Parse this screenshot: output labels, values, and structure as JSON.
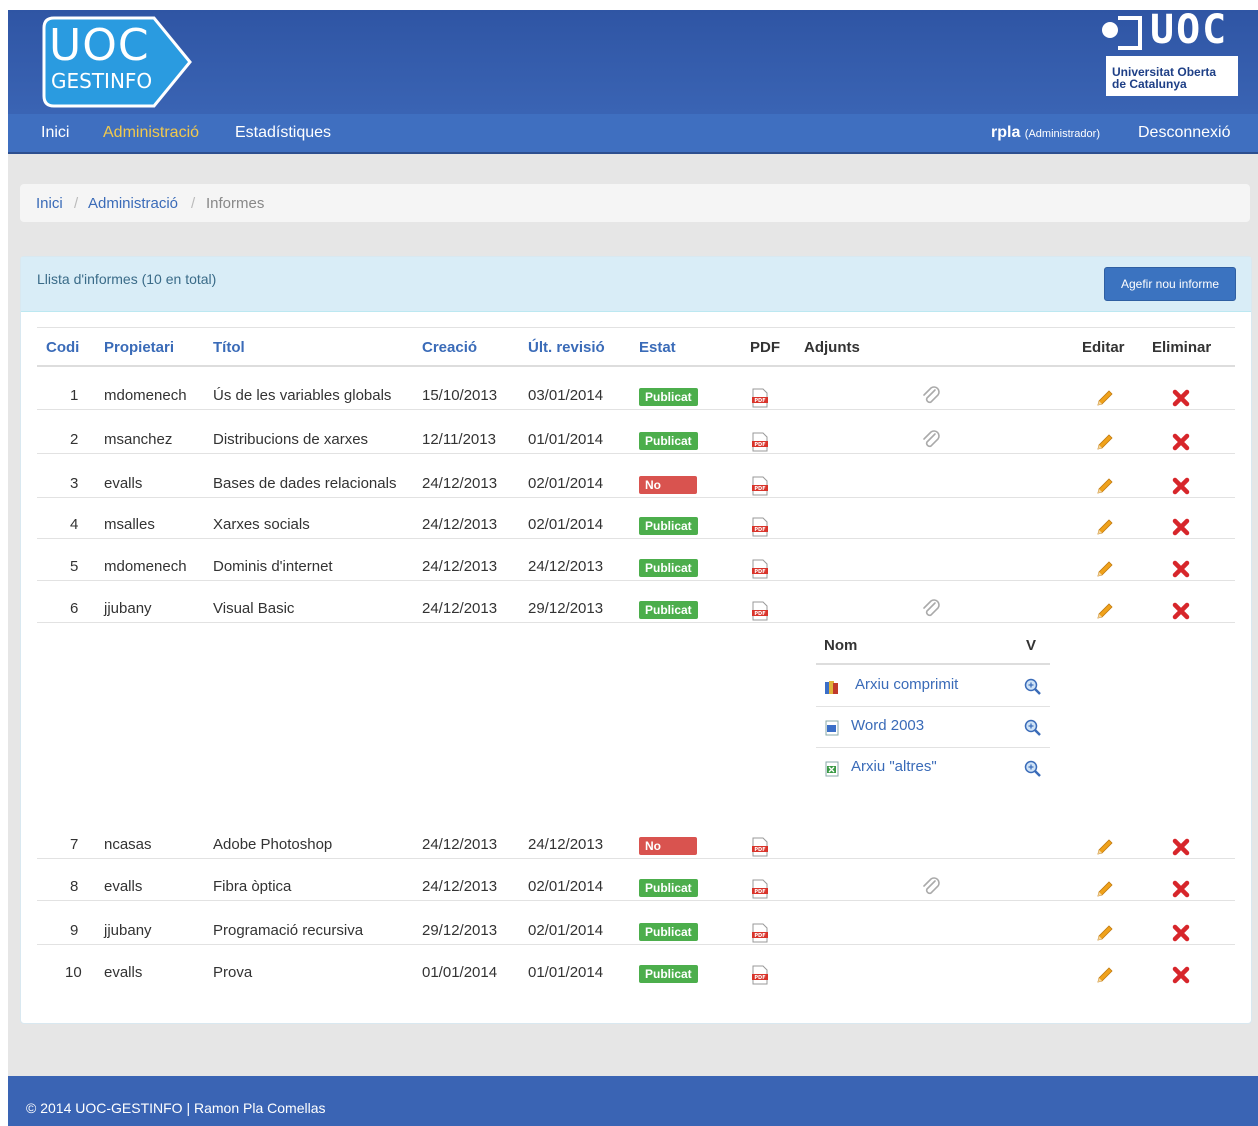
{
  "brand": {
    "logo_line1": "UOC",
    "logo_line2": "GESTINFO",
    "uni_word": "UOC",
    "uni_line1": "Universitat Oberta",
    "uni_line2": "de Catalunya"
  },
  "nav": {
    "items": [
      "Inici",
      "Administració",
      "Estadístiques"
    ],
    "active": "Administració",
    "user": "rpla",
    "role": "(Administrador)",
    "logout": "Desconnexió"
  },
  "breadcrumb": {
    "items": [
      "Inici",
      "Administració",
      "Informes"
    ],
    "separator": "/"
  },
  "panel": {
    "title": "Llista d'informes (10 en total)",
    "add_button": "Agefir nou informe"
  },
  "table": {
    "headers": [
      "Codi",
      "Propietari",
      "Títol",
      "Creació",
      "Últ. revisió",
      "Estat",
      "PDF",
      "Adjunts",
      "Editar",
      "Eliminar"
    ],
    "rows": [
      {
        "code": "1",
        "owner": "mdomenech",
        "title": "Ús de les variables globals",
        "created": "15/10/2013",
        "revised": "03/01/2014",
        "status": "Publicat",
        "published": true,
        "attachment": true
      },
      {
        "code": "2",
        "owner": "msanchez",
        "title": "Distribucions de xarxes",
        "created": "12/11/2013",
        "revised": "01/01/2014",
        "status": "Publicat",
        "published": true,
        "attachment": true
      },
      {
        "code": "3",
        "owner": "evalls",
        "title": "Bases de dades relacionals",
        "created": "24/12/2013",
        "revised": "02/01/2014",
        "status": "No publicat",
        "published": false,
        "attachment": false
      },
      {
        "code": "4",
        "owner": "msalles",
        "title": "Xarxes socials",
        "created": "24/12/2013",
        "revised": "02/01/2014",
        "status": "Publicat",
        "published": true,
        "attachment": false
      },
      {
        "code": "5",
        "owner": "mdomenech",
        "title": "Dominis d'internet",
        "created": "24/12/2013",
        "revised": "24/12/2013",
        "status": "Publicat",
        "published": true,
        "attachment": false
      },
      {
        "code": "6",
        "owner": "jjubany",
        "title": "Visual Basic",
        "created": "24/12/2013",
        "revised": "29/12/2013",
        "status": "Publicat",
        "published": true,
        "attachment": true
      },
      {
        "code": "7",
        "owner": "ncasas",
        "title": "Adobe Photoshop",
        "created": "24/12/2013",
        "revised": "24/12/2013",
        "status": "No publicat",
        "published": false,
        "attachment": false
      },
      {
        "code": "8",
        "owner": "evalls",
        "title": "Fibra òptica",
        "created": "24/12/2013",
        "revised": "02/01/2014",
        "status": "Publicat",
        "published": true,
        "attachment": true
      },
      {
        "code": "9",
        "owner": "jjubany",
        "title": "Programació recursiva",
        "created": "29/12/2013",
        "revised": "02/01/2014",
        "status": "Publicat",
        "published": true,
        "attachment": false
      },
      {
        "code": "10",
        "owner": "evalls",
        "title": "Prova",
        "created": "01/01/2014",
        "revised": "01/01/2014",
        "status": "Publicat",
        "published": true,
        "attachment": false
      }
    ]
  },
  "attachments": {
    "headers": [
      "Nom",
      "V"
    ],
    "items": [
      {
        "name": "Arxiu comprimit",
        "icon": "archive-icon"
      },
      {
        "name": "Word 2003",
        "icon": "word-icon"
      },
      {
        "name": "Arxiu \"altres\"",
        "icon": "excel-icon"
      }
    ]
  },
  "colors": {
    "header": "#3a64b4",
    "navbar": "#3f6fc0",
    "active_nav": "#f2c94c",
    "link": "#3a6bb8",
    "published": "#4cae4c",
    "unpublished": "#d9534f"
  },
  "footer": {
    "text": "© 2014 UOC-GESTINFO | Ramon Pla Comellas"
  }
}
